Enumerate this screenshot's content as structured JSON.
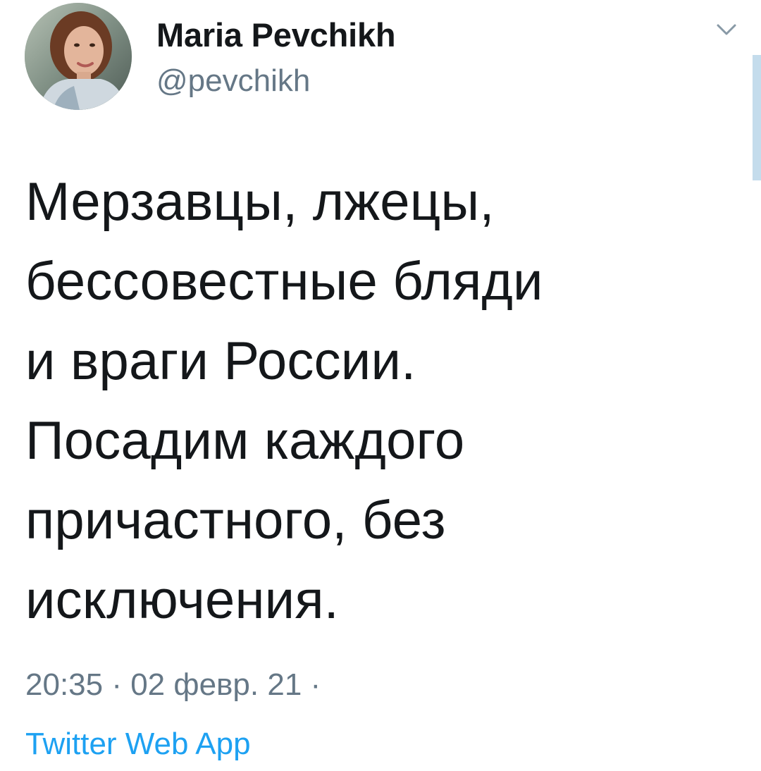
{
  "user": {
    "display_name": "Maria Pevchikh",
    "handle": "@pevchikh"
  },
  "tweet": {
    "text": "Мерзавцы, лжецы,\nбессовестные бляди\nи враги России.\nПосадим каждого\nпричастного, без\nисключения.",
    "timestamp": "20:35 · 02 февр. 21 ·",
    "source": "Twitter Web App"
  },
  "icons": {
    "menu": "chevron-down-icon",
    "avatar": "profile-photo"
  },
  "colors": {
    "text": "#14171a",
    "secondary": "#657786",
    "link": "#1da1f2",
    "scrollbar": "#c4dcec"
  }
}
